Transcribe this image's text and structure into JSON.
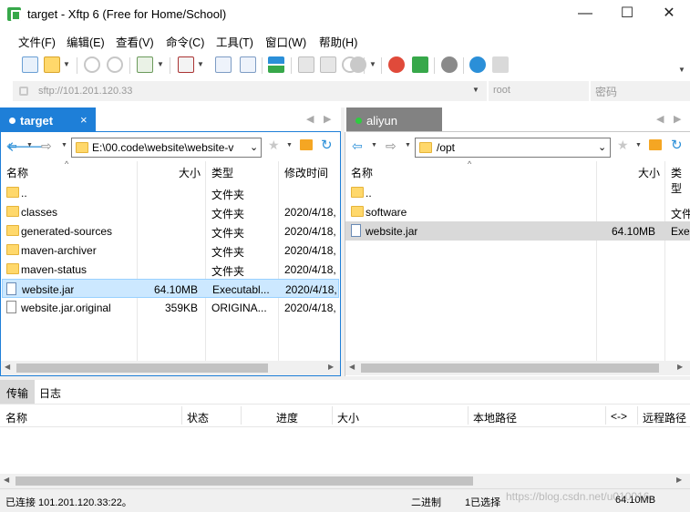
{
  "window": {
    "title": "target - Xftp 6 (Free for Home/School)",
    "minimize": "—",
    "maximize": "☐",
    "close": "✕"
  },
  "menu": [
    "文件(F)",
    "编辑(E)",
    "查看(V)",
    "命令(C)",
    "工具(T)",
    "窗口(W)",
    "帮助(H)"
  ],
  "address": {
    "host_placeholder": "sftp://101.201.120.33",
    "user_placeholder": "root",
    "password_placeholder": "密码"
  },
  "session_tabs": {
    "left": {
      "label": "target",
      "close": "×",
      "color": "#1e7fd8"
    },
    "right": {
      "label": "aliyun",
      "color": "#828282"
    }
  },
  "left_pane": {
    "path": "E:\\00.code\\website\\website-v",
    "columns": [
      "名称",
      "大小",
      "类型",
      "修改时间"
    ],
    "rows": [
      {
        "name": "..",
        "size": "",
        "type": "文件夹",
        "modified": "",
        "icon": "folder-icon"
      },
      {
        "name": "classes",
        "size": "",
        "type": "文件夹",
        "modified": "2020/4/18,",
        "icon": "folder-icon"
      },
      {
        "name": "generated-sources",
        "size": "",
        "type": "文件夹",
        "modified": "2020/4/18,",
        "icon": "folder-icon"
      },
      {
        "name": "maven-archiver",
        "size": "",
        "type": "文件夹",
        "modified": "2020/4/18,",
        "icon": "folder-icon"
      },
      {
        "name": "maven-status",
        "size": "",
        "type": "文件夹",
        "modified": "2020/4/18,",
        "icon": "folder-icon"
      },
      {
        "name": "website.jar",
        "size": "64.10MB",
        "type": "Executabl...",
        "modified": "2020/4/18,",
        "icon": "jar-icon"
      },
      {
        "name": "website.jar.original",
        "size": "359KB",
        "type": "ORIGINA...",
        "modified": "2020/4/18,",
        "icon": "file-icon"
      }
    ]
  },
  "right_pane": {
    "path": "/opt",
    "columns": [
      "名称",
      "大小",
      "类型"
    ],
    "rows": [
      {
        "name": "..",
        "size": "",
        "type": "",
        "icon": "folder-icon"
      },
      {
        "name": "software",
        "size": "",
        "type": "文件",
        "icon": "folder-icon"
      },
      {
        "name": "website.jar",
        "size": "64.10MB",
        "type": "Exe",
        "icon": "jar-icon"
      }
    ]
  },
  "transfer": {
    "tabs": [
      "传输",
      "日志"
    ],
    "columns": [
      "名称",
      "状态",
      "进度",
      "大小",
      "本地路径",
      "<->",
      "远程路径"
    ]
  },
  "status": {
    "connection": "已连接 101.201.120.33:22。",
    "mode": "二进制",
    "selection": "1已选择",
    "size": "64.10MB",
    "watermark": "https://blog.csdn.net/u010016"
  },
  "colors": {
    "accent": "#1e7fd8",
    "selected_row": "#cce8ff",
    "remote_selected_row": "#d9d9d9",
    "folder": "#ffd86b"
  }
}
